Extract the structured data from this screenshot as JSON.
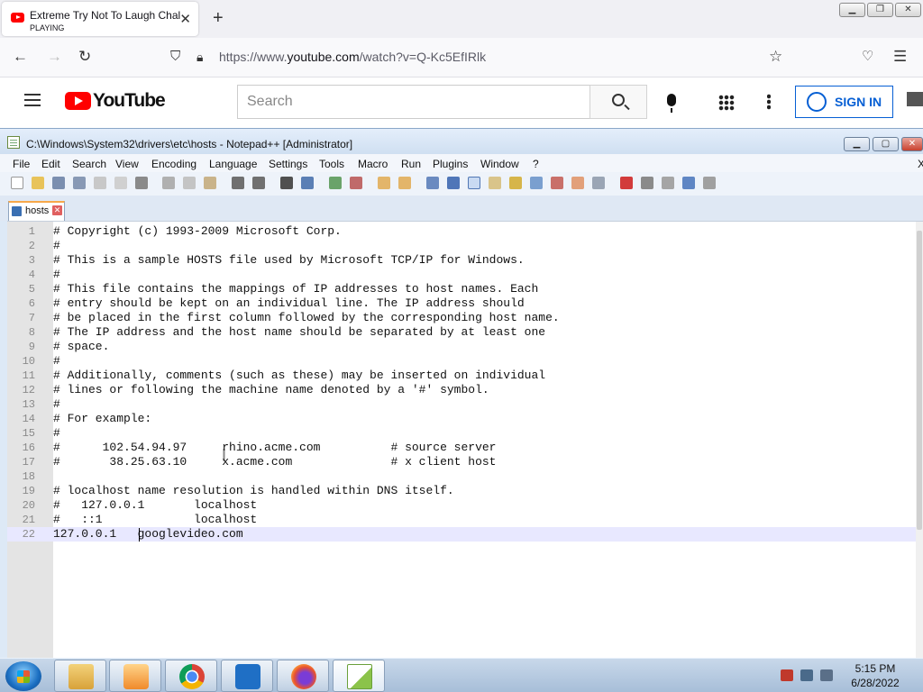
{
  "browser": {
    "tab": {
      "title": "Extreme Try Not To Laugh Chal",
      "subtitle": "PLAYING"
    },
    "url_prefix": "https://www.",
    "url_domain": "youtube.com",
    "url_path": "/watch?v=Q-Kc5EfIRlk",
    "icons": [
      "back-icon",
      "forward-icon",
      "reload-icon",
      "shield-icon",
      "lock-icon",
      "bookmark-star-icon",
      "pocket-icon",
      "menu-icon"
    ]
  },
  "youtube": {
    "logo_text": "YouTube",
    "search_placeholder": "Search",
    "sign_in_label": "SIGN IN",
    "brand_color": "#ff0000",
    "accent_color": "#065fd4"
  },
  "notepad": {
    "title": "C:\\Windows\\System32\\drivers\\etc\\hosts - Notepad++ [Administrator]",
    "menu": [
      "File",
      "Edit",
      "Search",
      "View",
      "Encoding",
      "Language",
      "Settings",
      "Tools",
      "Macro",
      "Run",
      "Plugins",
      "Window",
      "?"
    ],
    "menu_close": "X",
    "tab_name": "hosts",
    "lines": [
      {
        "n": "1",
        "text": "# Copyright (c) 1993-2009 Microsoft Corp."
      },
      {
        "n": "2",
        "text": "#"
      },
      {
        "n": "3",
        "text": "# This is a sample HOSTS file used by Microsoft TCP/IP for Windows."
      },
      {
        "n": "4",
        "text": "#"
      },
      {
        "n": "5",
        "text": "# This file contains the mappings of IP addresses to host names. Each"
      },
      {
        "n": "6",
        "text": "# entry should be kept on an individual line. The IP address should"
      },
      {
        "n": "7",
        "text": "# be placed in the first column followed by the corresponding host name."
      },
      {
        "n": "8",
        "text": "# The IP address and the host name should be separated by at least one"
      },
      {
        "n": "9",
        "text": "# space."
      },
      {
        "n": "10",
        "text": "#"
      },
      {
        "n": "11",
        "text": "# Additionally, comments (such as these) may be inserted on individual"
      },
      {
        "n": "12",
        "text": "# lines or following the machine name denoted by a '#' symbol."
      },
      {
        "n": "13",
        "text": "#"
      },
      {
        "n": "14",
        "text": "# For example:"
      },
      {
        "n": "15",
        "text": "#"
      },
      {
        "n": "16",
        "text": "#      102.54.94.97     rhino.acme.com          # source server"
      },
      {
        "n": "17",
        "text": "#       38.25.63.10     x.acme.com              # x client host"
      },
      {
        "n": "18",
        "text": ""
      },
      {
        "n": "19",
        "text": "# localhost name resolution is handled within DNS itself."
      },
      {
        "n": "20",
        "text": "#   127.0.0.1       localhost"
      },
      {
        "n": "21",
        "text": "#   ::1             localhost"
      },
      {
        "n": "22",
        "text": "127.0.0.1   googlevideo.com"
      }
    ],
    "current_line": "22"
  },
  "taskbar": {
    "apps": [
      "explorer-icon",
      "media-player-icon",
      "chrome-icon",
      "app-h-icon",
      "firefox-icon",
      "notepad-plus-plus-icon"
    ],
    "time": "5:15 PM",
    "date": "6/28/2022"
  }
}
